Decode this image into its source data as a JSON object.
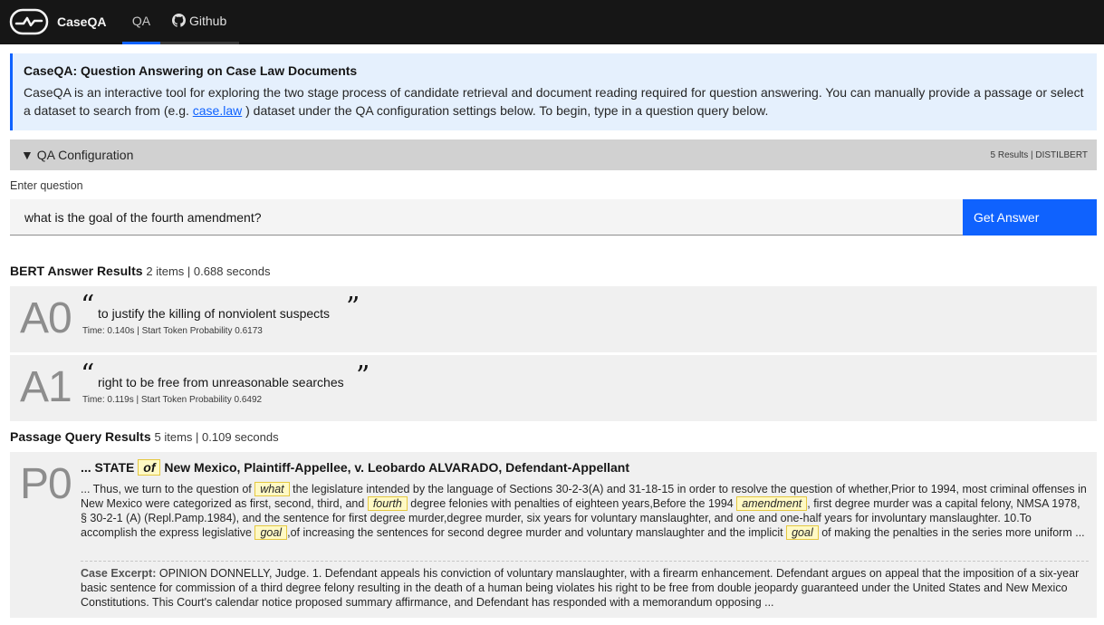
{
  "nav": {
    "brand": "CaseQA",
    "tab_qa": "QA",
    "tab_github": "Github"
  },
  "intro": {
    "title": "CaseQA: Question Answering on Case Law Documents",
    "text_before_link": "CaseQA is an interactive tool for exploring the two stage process of candidate retrieval and document reading required for question answering. You can manually provide a passage or select a dataset to search from (e.g. ",
    "link": "case.law",
    "text_after_link": " ) dataset under the QA configuration settings below. To begin, type in a question query below."
  },
  "config": {
    "label": "▼ QA Configuration",
    "status": "5 Results | DISTILBERT"
  },
  "question": {
    "label": "Enter question",
    "value": "what is the goal of the fourth amendment?",
    "button": "Get Answer"
  },
  "bert": {
    "heading": "BERT Answer Results",
    "meta": "2 items | 0.688 seconds",
    "answers": [
      {
        "id": "A0",
        "text": "to justify the killing of nonviolent suspects",
        "meta": "Time: 0.140s | Start Token Probability 0.6173"
      },
      {
        "id": "A1",
        "text": "right to be free from unreasonable searches",
        "meta": "Time: 0.119s | Start Token Probability 0.6492"
      }
    ]
  },
  "passages": {
    "heading": "Passage Query Results",
    "meta": "5 items | 0.109 seconds",
    "items": [
      {
        "id": "P0",
        "title_pre": "... STATE ",
        "title_hl": "of",
        "title_post": " New Mexico, Plaintiff-Appellee, v. Leobardo ALVARADO, Defendant-Appellant",
        "body": [
          "... Thus, we turn to the question of ",
          "what",
          " the legislature intended by the language of Sections 30-2-3(A) and 31-18-15 in order to resolve the question of whether,Prior to 1994, most criminal offenses in New Mexico were categorized as first, second, third, and ",
          "fourth",
          " degree felonies with penalties of eighteen years,Before the 1994 ",
          "amendment",
          ", first degree murder was a capital felony, NMSA 1978, § 30-2-1 (A) (Repl.Pamp.1984), and the sentence for first degree murder,degree murder, six years for voluntary manslaughter, and one and one-half years for involuntary manslaughter. 10.To accomplish the express legislative ",
          "goal",
          ",of increasing the sentences for second degree murder and voluntary manslaughter and the implicit ",
          "goal",
          " of making the penalties in the series more uniform ..."
        ],
        "excerpt_label": "Case Excerpt:",
        "excerpt": " OPINION DONNELLY, Judge. 1. Defendant appeals his conviction of voluntary manslaughter, with a firearm enhancement. Defendant argues on appeal that the imposition of a six-year basic sentence for commission of a third degree felony resulting in the death of a human being violates his right to be free from double jeopardy guaranteed under the United States and New Mexico Constitutions. This Court's calendar notice proposed summary affirmance, and Defendant has responded with a memorandum opposing ..."
      }
    ]
  }
}
